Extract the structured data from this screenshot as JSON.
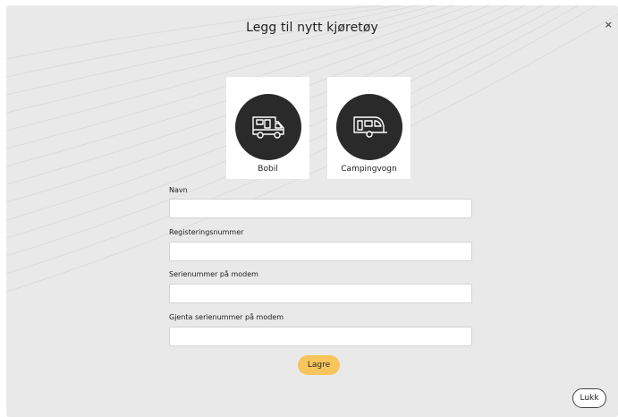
{
  "dialog": {
    "title": "Legg til nytt kjøretøy",
    "close_symbol": "×"
  },
  "vehicle_types": [
    {
      "label": "Bobil",
      "icon": "motorhome-icon"
    },
    {
      "label": "Campingvogn",
      "icon": "caravan-icon"
    }
  ],
  "form": {
    "fields": [
      {
        "label": "Navn",
        "value": "",
        "placeholder": ""
      },
      {
        "label": "Registeringsnummer",
        "value": "",
        "placeholder": ""
      },
      {
        "label": "Serienummer på modem",
        "value": "",
        "placeholder": ""
      },
      {
        "label": "Gjenta serienummer på modem",
        "value": "",
        "placeholder": ""
      }
    ],
    "save_label": "Lagre"
  },
  "footer": {
    "close_label": "Lukk"
  },
  "colors": {
    "backdrop": "#e9e9e9",
    "card": "#ffffff",
    "icon_circle": "#2a2a2a",
    "save_button": "#f7c55c"
  }
}
